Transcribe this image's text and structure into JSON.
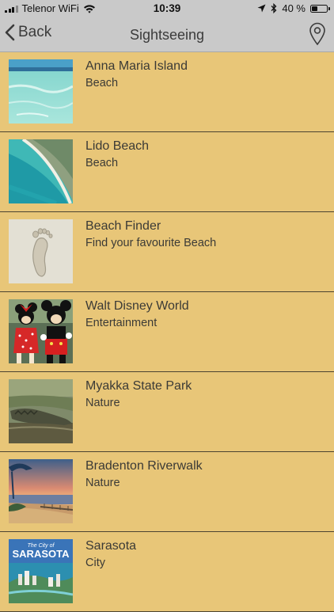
{
  "status": {
    "carrier": "Telenor WiFi",
    "time": "10:39",
    "battery": "40 %",
    "battery_level": 0.4
  },
  "nav": {
    "back_label": "Back",
    "title": "Sightseeing"
  },
  "items": [
    {
      "title": "Anna Maria Island",
      "subtitle": "Beach"
    },
    {
      "title": "Lido Beach",
      "subtitle": "Beach"
    },
    {
      "title": "Beach Finder",
      "subtitle": "Find your favourite Beach"
    },
    {
      "title": "Walt Disney World",
      "subtitle": "Entertainment"
    },
    {
      "title": "Myakka State Park",
      "subtitle": "Nature"
    },
    {
      "title": "Bradenton Riverwalk",
      "subtitle": "Nature"
    },
    {
      "title": "Sarasota",
      "subtitle": "City",
      "thumb_text": [
        "The City of",
        "SARASOTA"
      ]
    }
  ],
  "colors": {
    "background": "#e8c678",
    "bar": "#c9c9c9",
    "separator": "#4b4331"
  }
}
